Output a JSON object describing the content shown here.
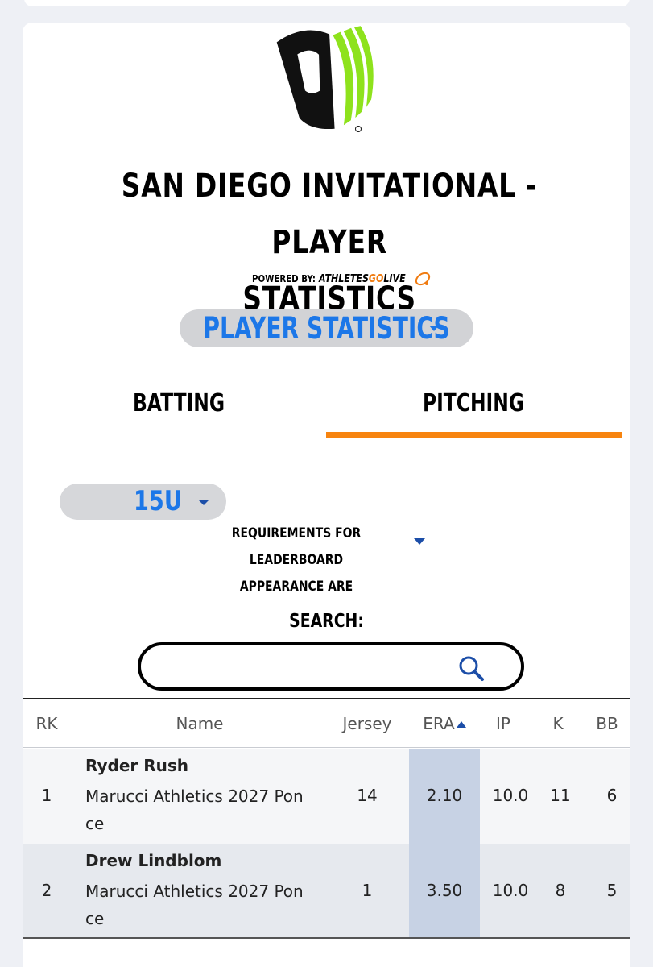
{
  "header": {
    "title_line1": "SAN DIEGO INVITATIONAL - PLAYER",
    "title_line2": "STATISTICS",
    "powered_by": "POWERED BY:",
    "brand_part1": "ATHLETES",
    "brand_part2": "GO",
    "brand_part3": "LIVE"
  },
  "view_select": {
    "label": "PLAYER STATISTICS"
  },
  "tabs": [
    {
      "label": "BATTING",
      "active": false
    },
    {
      "label": "PITCHING",
      "active": true
    }
  ],
  "age_select": {
    "label": "15U"
  },
  "requirements": {
    "line1": "REQUIREMENTS FOR LEADERBOARD",
    "line2": "APPEARANCE ARE"
  },
  "search": {
    "label": "SEARCH:",
    "value": "",
    "placeholder": ""
  },
  "table": {
    "columns": [
      "RK",
      "Name",
      "Jersey",
      "ERA",
      "IP",
      "K",
      "BB"
    ],
    "sorted_column": "ERA",
    "rows": [
      {
        "rk": "1",
        "name": "Ryder Rush",
        "team_line1": "Marucci Athletics 2027 Pon",
        "team_line2": "ce",
        "jersey": "14",
        "era": "2.10",
        "ip": "10.0",
        "k": "11",
        "bb": "6"
      },
      {
        "rk": "2",
        "name": "Drew Lindblom",
        "team_line1": "Marucci Athletics 2027 Pon",
        "team_line2": "ce",
        "jersey": "1",
        "era": "3.50",
        "ip": "10.0",
        "k": "8",
        "bb": "5"
      }
    ]
  },
  "colors": {
    "accent_blue": "#1c77e8",
    "tab_underline": "#f7840f",
    "logo_green": "#8ee21c"
  }
}
